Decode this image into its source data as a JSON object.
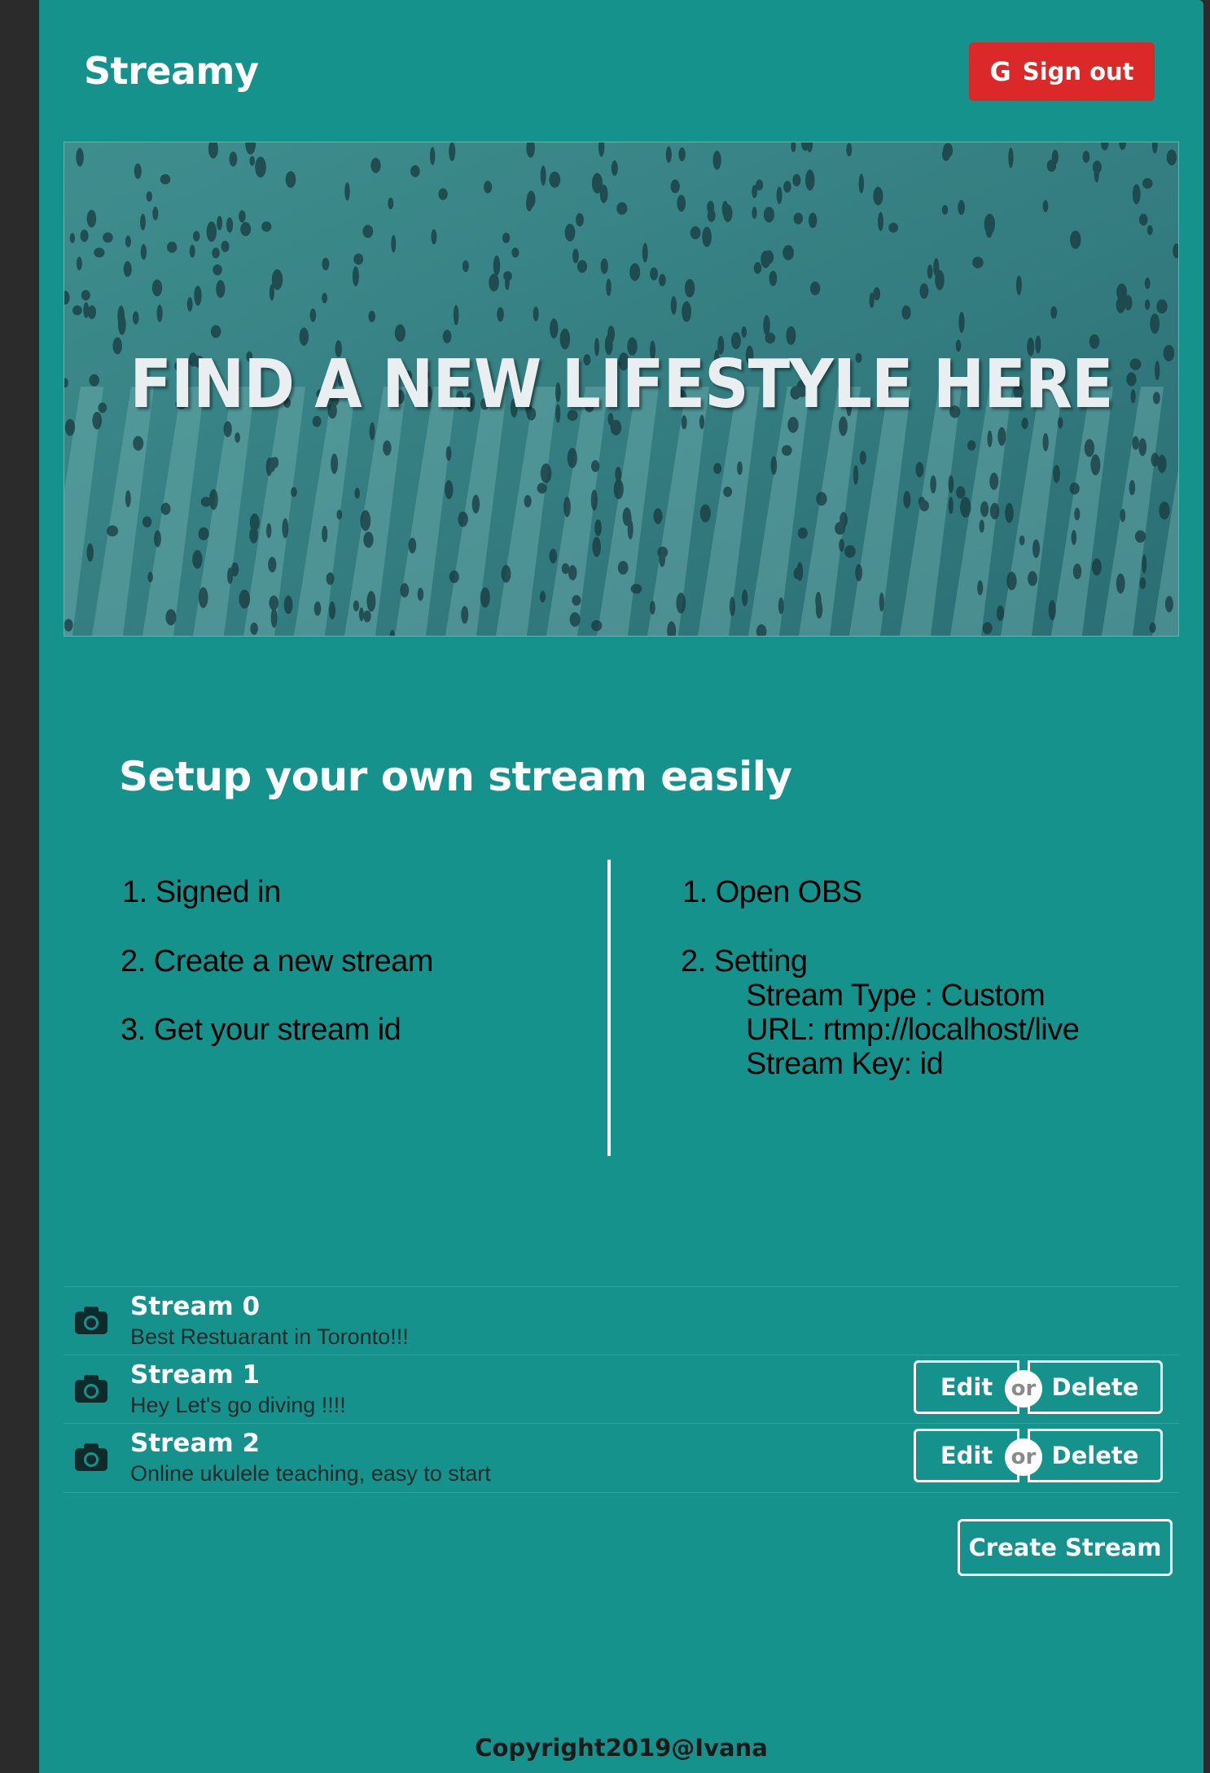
{
  "header": {
    "brand": "Streamy",
    "signout_label": "Sign out",
    "google_glyph": "G"
  },
  "hero": {
    "title": "FIND A NEW LIFESTYLE HERE",
    "image": "crowd-crosswalk-photo"
  },
  "setup": {
    "title": "Setup your own stream easily",
    "left_steps": [
      "1. Signed in",
      "2. Create a new stream",
      "3. Get your stream id"
    ],
    "right_steps": [
      "1. Open OBS",
      "2. Setting"
    ],
    "settings_lines": [
      "Stream Type : Custom",
      "URL: rtmp://localhost/live",
      "Stream Key: id"
    ]
  },
  "streams": [
    {
      "title": "Stream 0",
      "description": "Best Restuarant in Toronto!!!",
      "editable": false
    },
    {
      "title": "Stream 1",
      "description": "Hey Let's go diving !!!!",
      "editable": true
    },
    {
      "title": "Stream 2",
      "description": "Online ukulele teaching, easy to start",
      "editable": true
    }
  ],
  "actions": {
    "edit_label": "Edit",
    "or_label": "or",
    "delete_label": "Delete",
    "create_label": "Create Stream"
  },
  "footer": {
    "copyright": "Copyright2019@Ivana"
  },
  "colors": {
    "page_bg": "#16928d",
    "outer_bg": "#2b2b2b",
    "signout_red": "#db2828"
  },
  "icons": {
    "stream_icon": "camera-icon",
    "signout_icon": "google-icon"
  }
}
